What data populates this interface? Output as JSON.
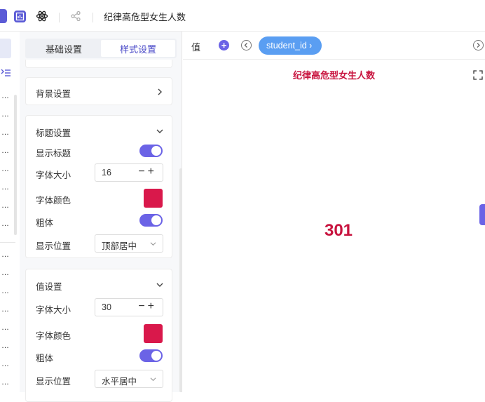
{
  "topbar": {
    "title": "纪律高危型女生人数",
    "icons": [
      "square-icon",
      "chart-icon",
      "atom-icon",
      "share-icon"
    ]
  },
  "leftstrip": {
    "dots": [
      "…",
      "…",
      "…",
      "…",
      "…",
      "…",
      "…",
      "…",
      "…",
      "…",
      "…",
      "…",
      "…",
      "…",
      "…",
      "…"
    ]
  },
  "panel": {
    "tabs": [
      {
        "label": "基础设置",
        "active": false
      },
      {
        "label": "样式设置",
        "active": true
      }
    ],
    "background": {
      "label": "背景设置"
    },
    "title_settings": {
      "header": "标题设置",
      "show_title": "显示标题",
      "font_size_label": "字体大小",
      "font_size": "16",
      "font_color_label": "字体颜色",
      "font_color": "#d9184b",
      "bold_label": "粗体",
      "position_label": "显示位置",
      "position": "顶部居中"
    },
    "value_settings": {
      "header": "值设置",
      "font_size_label": "字体大小",
      "font_size": "30",
      "font_color_label": "字体颜色",
      "font_color": "#d9184b",
      "bold_label": "粗体",
      "position_label": "显示位置",
      "position": "水平居中"
    }
  },
  "preview": {
    "value_label": "值",
    "field_pill": "student_id",
    "field_pill_arrow": "›",
    "card_title": "纪律高危型女生人数",
    "value": "301"
  },
  "colors": {
    "accent": "#6b63e6",
    "pill": "#5a9ef2",
    "value_red": "#c8143f"
  }
}
